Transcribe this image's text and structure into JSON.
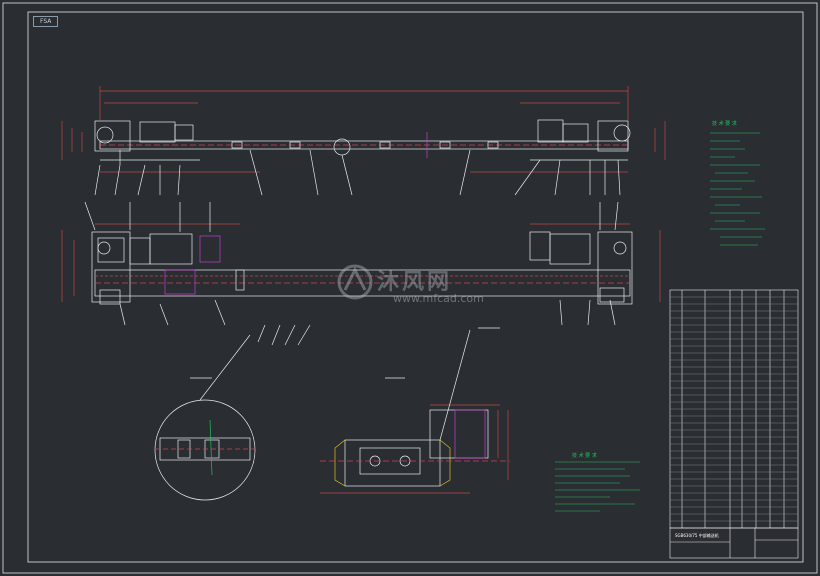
{
  "drawing": {
    "sheet_tag": "FSA",
    "watermark_cn": "沐风网",
    "watermark_url": "www.mfcad.com",
    "notes_title_right": "技 术 要 求",
    "notes_title_bottom": "技 术 要 求",
    "title_block_name": "SGB630/75 中部输送机"
  },
  "colors": {
    "background": "#2a2d31",
    "frame": "#c8d0d8",
    "geometry": "#e8ecf0",
    "dimension": "#c04848",
    "centerline": "#d84050",
    "annotation": "#20c060",
    "highlight": "#c040d0",
    "crossing": "#e0c020"
  }
}
